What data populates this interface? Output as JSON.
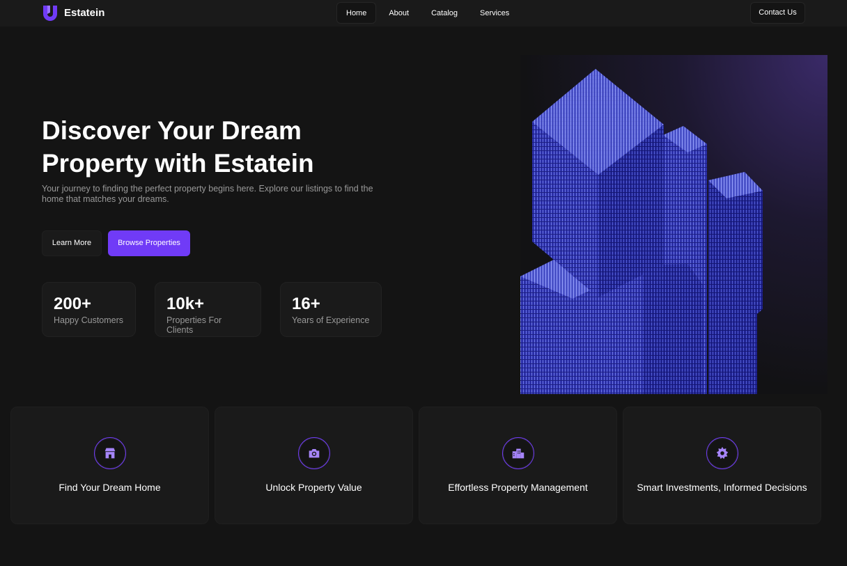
{
  "nav": {
    "brand": "Estatein",
    "links": [
      {
        "label": "Home",
        "active": true
      },
      {
        "label": "About",
        "active": false
      },
      {
        "label": "Catalog",
        "active": false
      },
      {
        "label": "Services",
        "active": false
      }
    ],
    "contact_label": "Contact Us"
  },
  "hero": {
    "title_line1": "Discover Your Dream",
    "title_line2": "Property with Estatein",
    "subtitle": "Your journey to finding the perfect property begins here. Explore our listings to find the home that matches your dreams.",
    "learn_more_label": "Learn More",
    "browse_label": "Browse Properties",
    "stats": [
      {
        "value": "200+",
        "label": "Happy Customers"
      },
      {
        "value": "10k+",
        "label": "Properties For Clients"
      },
      {
        "value": "16+",
        "label": "Years of Experience"
      }
    ],
    "image_icon": "building-photo"
  },
  "features": [
    {
      "title": "Find Your Dream Home",
      "icon": "home-store-icon"
    },
    {
      "title": "Unlock Property Value",
      "icon": "camera-icon"
    },
    {
      "title": "Effortless Property Management",
      "icon": "buildings-icon"
    },
    {
      "title": "Smart Investments, Informed Decisions",
      "icon": "sun-badge-icon"
    }
  ],
  "colors": {
    "accent": "#703BF7",
    "background": "#141414",
    "surface": "#1a1a1a",
    "muted_text": "#999999"
  }
}
